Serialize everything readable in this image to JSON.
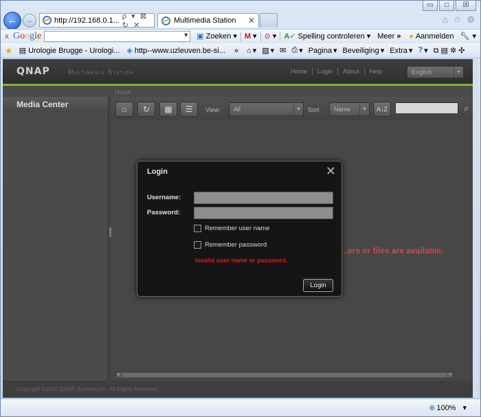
{
  "browser": {
    "address": "http://192.168.0.1...",
    "address_tools": "ρ ▾ ⊠ ↻ ✕",
    "tab_title": "Multimedia Station",
    "tab_close": "✕",
    "win_minimize": "▭",
    "win_maximize": "□",
    "win_close": "☒"
  },
  "google_toolbar": {
    "close": "x",
    "logo": [
      "G",
      "o",
      "o",
      "g",
      "l",
      "e"
    ],
    "search_label": "Zoeken",
    "gmail": "M",
    "spell_check": "Spelling controleren",
    "more": "Meer",
    "more_arrows": "»",
    "sign_in": "Aanmelden"
  },
  "favorites_bar": {
    "links": [
      {
        "label": "Urologie Brugge - Urologi..."
      },
      {
        "label": "http--www.uzleuven.be-si..."
      }
    ],
    "overflow": "»",
    "commands": [
      "Pagina",
      "Beveiliging",
      "Extra"
    ]
  },
  "qnap": {
    "logo": "QNAP",
    "subtitle": "Multimedia Station",
    "top_links": [
      "Home",
      "Login",
      "About",
      "Help"
    ],
    "language": "English",
    "breadcrumb": "Home",
    "sidebar_title": "Media Center",
    "view_label": "View:",
    "view_value": "All",
    "sort_label": "Sort",
    "sort_value": "Name",
    "sort_az": "A↓Z",
    "empty_message": "...ers or files are available.",
    "copyright": "Copyright ©2010 QNAP Systems,Inc. All Rights Reserved."
  },
  "login_dialog": {
    "title": "Login",
    "username_label": "Username:",
    "password_label": "Password:",
    "remember_username": "Remember user name",
    "remember_password": "Remember password",
    "error": "Invalid user name or password.",
    "button": "Login",
    "close": "✕"
  },
  "status_bar": {
    "zoom": "100%"
  }
}
